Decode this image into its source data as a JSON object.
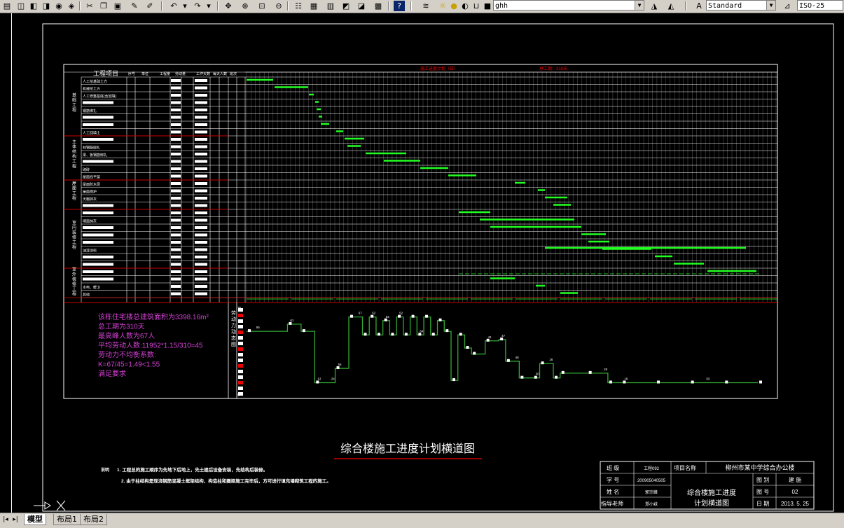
{
  "toolbar": {
    "layer_combo_value": "ghh",
    "text_style_value": "Standard",
    "dim_style_value": "ISO-25"
  },
  "drawing": {
    "gantt_header_title": "工程项目",
    "col_headers": [
      "序号",
      "单位",
      "工程量",
      "劳动量",
      "工作天数",
      "每天人数",
      "班次"
    ],
    "red_header_1": "施工进度计划（日）",
    "red_header_2": "总工期：310天",
    "group_labels": [
      "基础工程",
      "主体结构工程",
      "屋面工程",
      "室内装修工程",
      "室外装修工程"
    ],
    "task_labels": [
      "人工挖基础土方",
      "机械挖土方",
      "人工修整基底(含回填)",
      "",
      "钢筋绑扎",
      "",
      "",
      "人工回填土",
      "",
      "柱钢筋绑扎",
      "梁、板钢筋绑扎",
      "",
      "砌砖",
      "屋面找平层",
      "屋面防水层",
      "屋面保护",
      "天棚抹灰",
      "",
      "",
      "墙面抹灰",
      "",
      "",
      "",
      "油漆涂料",
      "",
      "",
      "",
      "",
      "水电、暖卫",
      "其他"
    ],
    "summary_lines": [
      "该栋住宅楼总建筑面积为3398.16m²",
      "总工期为310天",
      "最高峰人数为67人",
      "平均劳动人数:11952*1.15/310=45",
      "劳动力不均衡系数:",
      "K=67/45=1.49<1.55",
      "满足要求"
    ],
    "chart_axis_title": "劳动力动态图",
    "notes_label": "说明",
    "notes": [
      "1. 工程总的施工顺序为先地下后地上，先土建后设备安装，先结构后装修。",
      "2. 由于柱结构是现浇钢筋混凝土框架结构，构造柱和圈梁施工完毕后，方可进行填充墙砌筑工程的施工。"
    ],
    "drawing_title": "综合楼施工进度计划横道图",
    "title_block": {
      "class_label": "班  级",
      "class_value": "工程092",
      "project_label": "项目名称",
      "project_value": "柳州市某中学综合办公楼",
      "student_no_label": "学  号",
      "student_no_value": "200905040505",
      "name_label": "姓  名",
      "name_value": "郭宗峰",
      "teacher_label": "指导老师",
      "teacher_value": "郑小妹",
      "drawing_name": "综合楼施工进度计划横道图",
      "category_label": "图  别",
      "category_value": "建  施",
      "number_label": "图  号",
      "number_value": "02",
      "date_label": "日  期",
      "date_value": "2013. 5. 25"
    }
  },
  "chart_data": {
    "type": "line",
    "title": "劳动力动态图",
    "series": [
      {
        "x": [
          0,
          12,
          16,
          20,
          26,
          30,
          34,
          36,
          38,
          40,
          42,
          44,
          46,
          48,
          50,
          52,
          54,
          56,
          58,
          60,
          62,
          64,
          66,
          70,
          74,
          76,
          80,
          84,
          86,
          90,
          92,
          100,
          106,
          110,
          120,
          130,
          140,
          150
        ],
        "values": [
          55,
          61,
          55,
          12,
          24,
          67,
          52,
          67,
          52,
          64,
          52,
          67,
          52,
          67,
          52,
          67,
          52,
          64,
          55,
          14,
          52,
          41,
          36,
          47,
          48,
          30,
          16,
          16,
          28,
          16,
          20,
          20,
          12,
          12,
          12,
          12,
          12,
          12
        ]
      }
    ],
    "data_labels": [
      "55",
      "61",
      "55",
      "12",
      "24",
      "67",
      "52",
      "53",
      "52",
      "64",
      "41",
      "47",
      "48",
      "30",
      "16",
      "28",
      "16",
      "20"
    ],
    "ylim": [
      0,
      75
    ],
    "yticks": [
      "75",
      "5"
    ],
    "grid": false,
    "legend": "none"
  },
  "tabs": {
    "model": "模型",
    "layout1": "布局1",
    "layout2": "布局2"
  }
}
